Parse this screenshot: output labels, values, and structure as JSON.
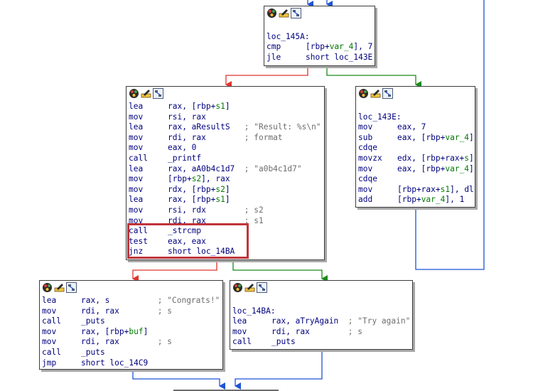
{
  "colors": {
    "false_edge": "#e0342c",
    "true_edge": "#1a8a1a",
    "normal_edge": "#1f52d6",
    "highlight": "#c0353b"
  },
  "toolbar_icons": [
    "color-palette-icon",
    "rename-node-icon",
    "graph-overview-icon"
  ],
  "blocks": {
    "loc_145A": {
      "label": "loc_145A:",
      "lines": [
        {
          "m": "cmp",
          "p1": "[rbp+",
          "s1": "var_4",
          "p2": "], 7"
        },
        {
          "m": "jle",
          "p1": "short loc_143E"
        }
      ]
    },
    "left_main": {
      "lines": [
        {
          "m": "lea",
          "p1": "rax, [rbp+",
          "s1": "s1",
          "p2": "]"
        },
        {
          "m": "mov",
          "p1": "rsi, rax"
        },
        {
          "m": "lea",
          "p1": "rax, aResultS",
          "c": "   ; \"Result: %s\\n\""
        },
        {
          "m": "mov",
          "p1": "rdi, rax",
          "c": "        ; format"
        },
        {
          "m": "mov",
          "p1": "eax, 0"
        },
        {
          "m": "call",
          "p1": "_printf"
        },
        {
          "m": "lea",
          "p1": "rax, aA0b4c1d7",
          "c": "  ; \"a0b4c1d7\""
        },
        {
          "m": "mov",
          "p1": "[rbp+",
          "s1": "s2",
          "p2": "], rax"
        },
        {
          "m": "mov",
          "p1": "rdx, [rbp+",
          "s1": "s2",
          "p2": "]"
        },
        {
          "m": "lea",
          "p1": "rax, [rbp+",
          "s1": "s1",
          "p2": "]"
        },
        {
          "m": "mov",
          "p1": "rsi, rdx",
          "c": "        ; s2"
        },
        {
          "m": "mov",
          "p1": "rdi, rax",
          "c": "        ; s1"
        },
        {
          "m": "call",
          "p1": "_strcmp"
        },
        {
          "m": "test",
          "p1": "eax, eax"
        },
        {
          "m": "jnz",
          "p1": "short loc_14BA"
        }
      ]
    },
    "loc_143E": {
      "label": "loc_143E:",
      "lines": [
        {
          "m": "mov",
          "p1": "eax, 7"
        },
        {
          "m": "sub",
          "p1": "eax, [rbp+",
          "s1": "var_4",
          "p2": "]"
        },
        {
          "m": "cdqe",
          "p1": ""
        },
        {
          "m": "movzx",
          "p1": "edx, [rbp+rax+",
          "s1": "s",
          "p2": "]"
        },
        {
          "m": "mov",
          "p1": "eax, [rbp+",
          "s1": "var_4",
          "p2": "]"
        },
        {
          "m": "cdqe",
          "p1": ""
        },
        {
          "m": "mov",
          "p1": "[rbp+rax+",
          "s1": "s1",
          "p2": "], dl"
        },
        {
          "m": "add",
          "p1": "[rbp+",
          "s1": "var_4",
          "p2": "], 1"
        }
      ]
    },
    "congrats": {
      "lines": [
        {
          "m": "lea",
          "p1": "rax, s",
          "c": "          ; \"Congrats!\""
        },
        {
          "m": "mov",
          "p1": "rdi, rax",
          "c": "        ; s"
        },
        {
          "m": "call",
          "p1": "_puts"
        },
        {
          "m": "mov",
          "p1": "rax, [rbp+",
          "s1": "buf",
          "p2": "]"
        },
        {
          "m": "mov",
          "p1": "rdi, rax",
          "c": "        ; s"
        },
        {
          "m": "call",
          "p1": "_puts"
        },
        {
          "m": "jmp",
          "p1": "short loc_14C9"
        }
      ]
    },
    "loc_14BA": {
      "label": "loc_14BA:",
      "lines": [
        {
          "m": "lea",
          "p1": "rax, aTryAgain",
          "c": "  ; \"Try again\""
        },
        {
          "m": "mov",
          "p1": "rdi, rax",
          "c": "        ; s"
        },
        {
          "m": "call",
          "p1": "_puts"
        }
      ]
    }
  }
}
